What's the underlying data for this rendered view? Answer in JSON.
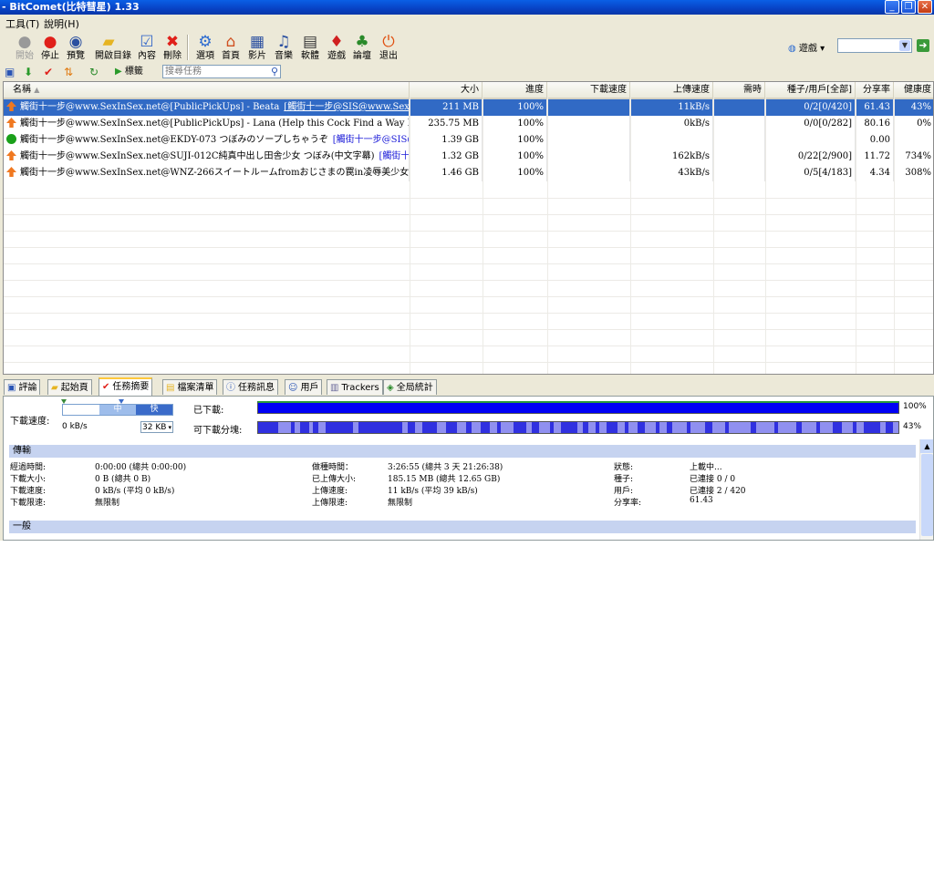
{
  "window": {
    "title": "- BitComet(比特彗星) 1.33"
  },
  "menu": [
    "工具(T)",
    "說明(H)"
  ],
  "toolbar": {
    "buttons": [
      {
        "label": "開始",
        "icon": "play-icon",
        "disabled": true
      },
      {
        "label": "停止",
        "icon": "stop-icon"
      },
      {
        "label": "預覽",
        "icon": "preview-icon"
      },
      {
        "label": "開啟目錄",
        "icon": "folder-icon"
      },
      {
        "label": "內容",
        "icon": "properties-icon"
      },
      {
        "label": "刪除",
        "icon": "delete-icon"
      },
      {
        "label": "選項",
        "icon": "options-icon"
      },
      {
        "label": "首頁",
        "icon": "home-icon"
      },
      {
        "label": "影片",
        "icon": "movie-icon"
      },
      {
        "label": "音樂",
        "icon": "music-icon"
      },
      {
        "label": "軟體",
        "icon": "software-icon"
      },
      {
        "label": "遊戲",
        "icon": "game-icon"
      },
      {
        "label": "論壇",
        "icon": "forum-icon"
      },
      {
        "label": "退出",
        "icon": "exit-icon"
      }
    ],
    "search_scope": "遊戲",
    "search_value": ""
  },
  "toolbar2": {
    "bookmark_label": "標籤",
    "search_placeholder": "搜尋任務"
  },
  "table": {
    "columns": [
      "名稱",
      "大小",
      "進度",
      "下載速度",
      "上傳速度",
      "需時",
      "種子/用戶[全部]",
      "分享率",
      "健康度"
    ],
    "rows": [
      {
        "name": "觸街十一步@www.SexInSex.net@[PublicPickUps] - Beata",
        "link": "[觸街十一步@SIS@www.SexInSex.net]",
        "size": "211 MB",
        "progress": "100%",
        "down": "",
        "up": "11kB/s",
        "eta": "",
        "peers": "0/2[0/420]",
        "ratio": "61.43",
        "health": "43%",
        "status": "uploading",
        "selected": true
      },
      {
        "name": "觸街十一步@www.SexInSex.net@[PublicPickUps] - Lana (Help this Cock Find a Way Home)",
        "link": "[觸街十一...",
        "size": "235.75 MB",
        "progress": "100%",
        "down": "",
        "up": "0kB/s",
        "eta": "",
        "peers": "0/0[0/282]",
        "ratio": "80.16",
        "health": "0%",
        "status": "uploading",
        "selected": false
      },
      {
        "name": "觸街十一步@www.SexInSex.net@EKDY-073 つぼみのソープしちゃうぞ",
        "link": "[觸街十一步@SIS@www.S...",
        "size": "1.39 GB",
        "progress": "100%",
        "down": "",
        "up": "",
        "eta": "",
        "peers": "",
        "ratio": "0.00",
        "health": "",
        "status": "done",
        "selected": false
      },
      {
        "name": "觸街十一步@www.SexInSex.net@SUJI-012C純真中出し田舎少女 つぼみ(中文字幕)",
        "link": "[觸街十一步...",
        "size": "1.32 GB",
        "progress": "100%",
        "down": "",
        "up": "162kB/s",
        "eta": "",
        "peers": "0/22[2/900]",
        "ratio": "11.72",
        "health": "734%",
        "status": "uploading",
        "selected": false
      },
      {
        "name": "觸街十一步@www.SexInSex.net@WNZ-266スイートルームfromおじさまの罠in凌辱美少女 つぼみ",
        "link": "[...",
        "size": "1.46 GB",
        "progress": "100%",
        "down": "",
        "up": "43kB/s",
        "eta": "",
        "peers": "0/5[4/183]",
        "ratio": "4.34",
        "health": "308%",
        "status": "uploading",
        "selected": false
      }
    ]
  },
  "tabs": [
    {
      "label": "評論",
      "icon": "comment-icon"
    },
    {
      "label": "起始頁",
      "icon": "startpage-icon"
    },
    {
      "label": "任務摘要",
      "icon": "summary-icon",
      "active": true
    },
    {
      "label": "檔案清單",
      "icon": "filelist-icon"
    },
    {
      "label": "任務訊息",
      "icon": "info-icon"
    },
    {
      "label": "用戶",
      "icon": "peers-icon"
    },
    {
      "label": "Trackers",
      "icon": "trackers-icon"
    },
    {
      "label": "全局統計",
      "icon": "stats-icon"
    }
  ],
  "summary": {
    "speed_label": "下載速度:",
    "slider": {
      "mid": "中",
      "fast": "快"
    },
    "current_speed": "0 kB/s",
    "limit_select": "32 KB",
    "downloaded_label": "已下載:",
    "downloaded_pct": "100%",
    "available_label": "可下載分塊:",
    "available_pct": "43%",
    "transfer_title": "傳輸",
    "transfer": [
      [
        [
          "經過時間:",
          "0:00:00 (總共 0:00:00)"
        ],
        [
          "做種時間：",
          "3:26:55 (總共 3 天 21:26:38)"
        ],
        [
          "狀態:",
          "上載中..."
        ]
      ],
      [
        [
          "下載大小:",
          "0 B (總共 0 B)"
        ],
        [
          "已上傳大小:",
          "185.15 MB (總共 12.65 GB)"
        ],
        [
          "種子:",
          "已連接 0 / 0"
        ]
      ],
      [
        [
          "下載速度:",
          "0 kB/s (平均 0 kB/s)"
        ],
        [
          "上傳速度:",
          "11 kB/s (平均 39 kB/s)"
        ],
        [
          "用戶:",
          "已連接 2 / 420"
        ]
      ],
      [
        [
          "下載限速:",
          "無限制"
        ],
        [
          "上傳限速:",
          "無限制"
        ],
        [
          "分享率:",
          "61.43"
        ]
      ]
    ],
    "general_title": "一般"
  }
}
